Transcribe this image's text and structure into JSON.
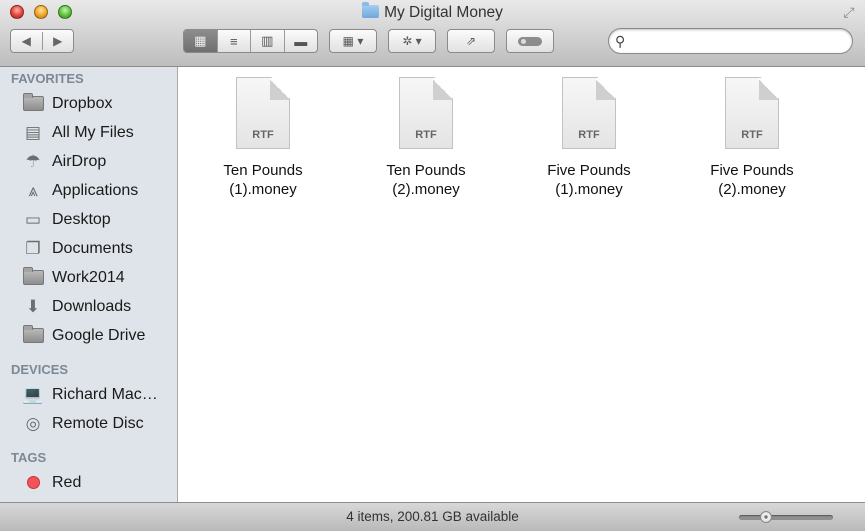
{
  "window": {
    "title": "My Digital Money",
    "buttons": {
      "close": "close",
      "minimize": "minimize",
      "zoom": "zoom"
    }
  },
  "toolbar": {
    "back_icon": "◀",
    "forward_icon": "▶",
    "view_icons": [
      "▦",
      "≡",
      "▥",
      "▬"
    ],
    "arrange_icon": "▦ ▾",
    "action_icon": "✲ ▾",
    "share_icon": "⇗",
    "search": {
      "value": "",
      "placeholder": "",
      "icon": "🔍"
    }
  },
  "sidebar": {
    "sections": [
      {
        "title": "FAVORITES",
        "items": [
          {
            "label": "Dropbox",
            "icon": "folder-icon"
          },
          {
            "label": "All My Files",
            "icon": "all-files-icon"
          },
          {
            "label": "AirDrop",
            "icon": "airdrop-icon"
          },
          {
            "label": "Applications",
            "icon": "applications-icon"
          },
          {
            "label": "Desktop",
            "icon": "desktop-icon"
          },
          {
            "label": "Documents",
            "icon": "documents-icon"
          },
          {
            "label": "Work2014",
            "icon": "folder-icon"
          },
          {
            "label": "Downloads",
            "icon": "downloads-icon"
          },
          {
            "label": "Google Drive",
            "icon": "folder-icon"
          }
        ]
      },
      {
        "title": "DEVICES",
        "items": [
          {
            "label": "Richard Mac…",
            "icon": "laptop-icon"
          },
          {
            "label": "Remote Disc",
            "icon": "disc-icon"
          }
        ]
      },
      {
        "title": "TAGS",
        "items": [
          {
            "label": "Red",
            "icon": "red-tag-icon",
            "color": "#f4525a"
          }
        ]
      }
    ]
  },
  "files": [
    {
      "name_line1": "Ten Pounds",
      "name_line2": "(1).money",
      "ext": "RTF"
    },
    {
      "name_line1": "Ten Pounds",
      "name_line2": "(2).money",
      "ext": "RTF"
    },
    {
      "name_line1": "Five Pounds",
      "name_line2": "(1).money",
      "ext": "RTF"
    },
    {
      "name_line1": "Five Pounds",
      "name_line2": "(2).money",
      "ext": "RTF"
    }
  ],
  "status": {
    "text": "4 items, 200.81 GB available",
    "icon_size_fraction": 0.25
  }
}
